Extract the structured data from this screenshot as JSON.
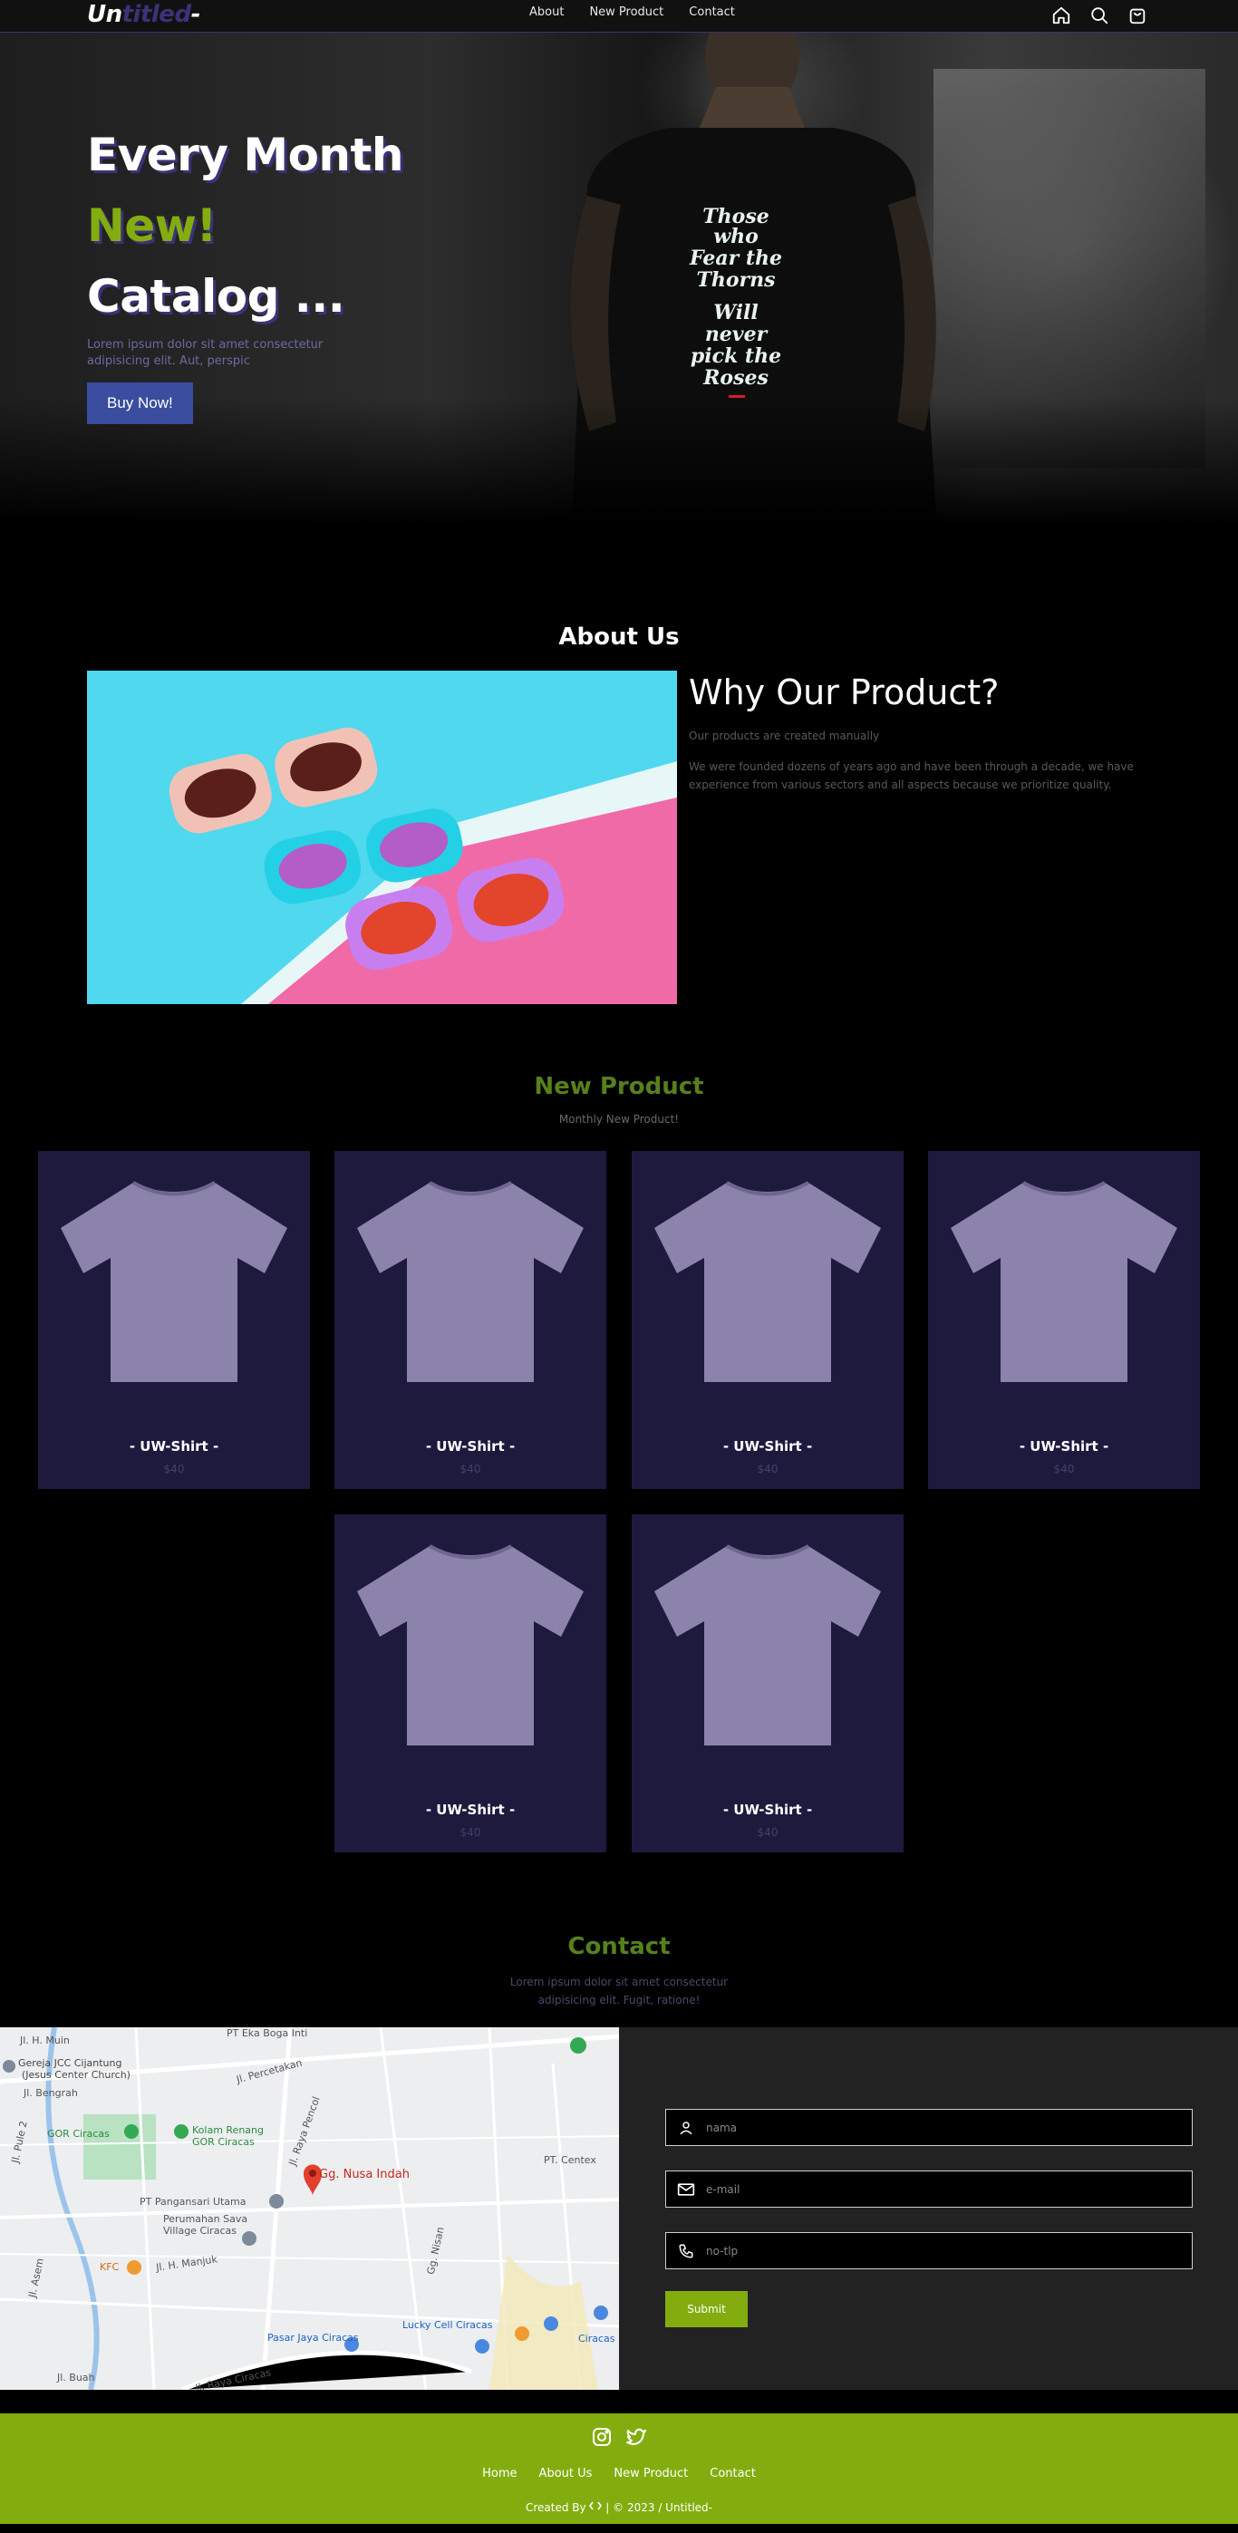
{
  "brand": {
    "part1": "Un",
    "part2": "titled",
    "part3": "-"
  },
  "nav": {
    "links": [
      "About",
      "New Product",
      "Contact"
    ]
  },
  "icons": {
    "home": "home-icon",
    "search": "search-icon",
    "cart": "shopping-bag-icon"
  },
  "hero": {
    "line1": "Every Month",
    "line2": "New!",
    "line3": "Catalog ...",
    "desc": "Lorem ipsum dolor sit amet consectetur adipisicing elit. Aut, perspic",
    "button": "Buy Now!",
    "shirt_print": [
      "Those",
      "who",
      "Fear the",
      "Thorns",
      "Will",
      "never",
      "pick the",
      "Roses"
    ]
  },
  "about": {
    "title": "About Us",
    "heading": "Why Our Product?",
    "p1": "Our products are created manually",
    "p2": "We were founded dozens of years ago and have been through a decade, we have experience from various sectors and all aspects because we prioritize quality."
  },
  "products": {
    "title": "New Product",
    "subtitle": "Monthly New Product!",
    "items": [
      {
        "name": "- UW-Shirt -",
        "price": "$40"
      },
      {
        "name": "- UW-Shirt -",
        "price": "$40"
      },
      {
        "name": "- UW-Shirt -",
        "price": "$40"
      },
      {
        "name": "- UW-Shirt -",
        "price": "$40"
      },
      {
        "name": "- UW-Shirt -",
        "price": "$40"
      },
      {
        "name": "- UW-Shirt -",
        "price": "$40"
      }
    ]
  },
  "contact": {
    "title": "Contact",
    "desc_line1": "Lorem ipsum dolor sit amet consectetur",
    "desc_line2": "adipisicing elit. Fugit, ratione!",
    "fields": {
      "name": "nama",
      "email": "e-mail",
      "phone": "no-tlp"
    },
    "submit": "Submit"
  },
  "map": {
    "labels": {
      "church": "Gereja JCC Cijantung",
      "church2": "(Jesus Center Church)",
      "pool": "Kolam Renang",
      "pool2": "GOR Ciracas",
      "gor": "GOR Ciracas",
      "pin": "Gg. Nusa Indah",
      "pt1": "PT Pangansari Utama",
      "housing1": "Perumahan Sava",
      "housing2": "Village Ciracas",
      "kfc": "KFC",
      "pasar": "Pasar Jaya Ciracas",
      "lucky": "Lucky Cell Ciracas",
      "ciracas": "Ciracas",
      "centex": "PT. Centex",
      "boga": "PT Eka Boga Inti",
      "raya": "Jl. Raya Ciracas",
      "muin": "Jl. H. Muin",
      "bengkel": "Jl. Bengrah",
      "pule": "Jl. Pule 2",
      "percetakan": "Jl. Percetakan",
      "pencol": "Jl. Raya Pencol",
      "manjuk": "Jl. H. Manjuk",
      "buah": "Jl. Buah",
      "asem": "Jl. Asem",
      "nisan": "Gg. Nisan"
    }
  },
  "footer": {
    "links": [
      "Home",
      "About Us",
      "New Product",
      "Contact"
    ],
    "credit_prefix": "Created By",
    "credit_suffix": "| © 2023 / Untitled-",
    "social": [
      "instagram-icon",
      "twitter-icon"
    ]
  },
  "colors": {
    "accent": "#3a3378",
    "green": "#83ad0f",
    "card": "#1e1a3e",
    "button": "#3a4d9e"
  }
}
